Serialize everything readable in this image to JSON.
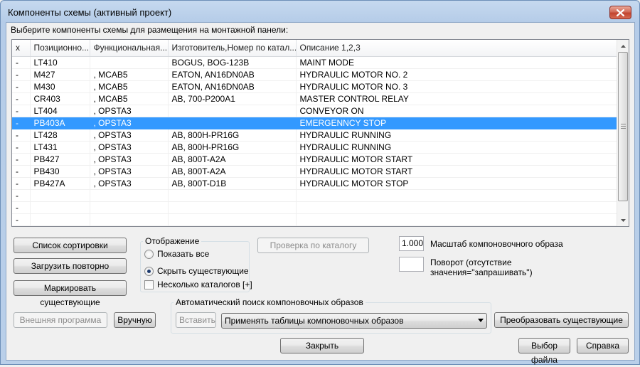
{
  "window": {
    "title": "Компоненты схемы (активный проект)"
  },
  "prompt": "Выберите компоненты схемы для размещения на монтажной панели:",
  "table": {
    "columns": [
      "x",
      "Позиционно...",
      "Функциональная...",
      "Изготовитель,Номер по катал...",
      "Описание 1,2,3"
    ],
    "rows": [
      [
        "-",
        "LT410",
        "",
        "BOGUS, BOG-123B",
        "MAINT MODE"
      ],
      [
        "-",
        "M427",
        ", MCAB5",
        "EATON, AN16DN0AB",
        "HYDRAULIC MOTOR NO. 2"
      ],
      [
        "-",
        "M430",
        ", MCAB5",
        "EATON, AN16DN0AB",
        "HYDRAULIC MOTOR NO. 3"
      ],
      [
        "-",
        "CR403",
        ", MCAB5",
        "AB, 700-P200A1",
        "MASTER CONTROL RELAY"
      ],
      [
        "-",
        "LT404",
        ", OPSTA3",
        "",
        "CONVEYOR ON"
      ],
      [
        "-",
        "PB403A",
        ", OPSTA3",
        "",
        "EMERGENNCY STOP"
      ],
      [
        "-",
        "LT428",
        ", OPSTA3",
        "AB, 800H-PR16G",
        "HYDRAULIC RUNNING"
      ],
      [
        "-",
        "LT431",
        ", OPSTA3",
        "AB, 800H-PR16G",
        "HYDRAULIC RUNNING"
      ],
      [
        "-",
        "PB427",
        ", OPSTA3",
        "AB, 800T-A2A",
        "HYDRAULIC MOTOR START"
      ],
      [
        "-",
        "PB430",
        ", OPSTA3",
        "AB, 800T-A2A",
        "HYDRAULIC MOTOR START"
      ],
      [
        "-",
        "PB427A",
        ", OPSTA3",
        "AB, 800T-D1B",
        "HYDRAULIC MOTOR STOP"
      ],
      [
        "-",
        "",
        "",
        "",
        ""
      ],
      [
        "-",
        "",
        "",
        "",
        ""
      ],
      [
        "-",
        "",
        "",
        "",
        ""
      ]
    ],
    "selected_row": 5
  },
  "buttons": {
    "sort_list": "Список сортировки",
    "reload": "Загрузить повторно",
    "mark_existing": "Маркировать существующие",
    "catalog_check": "Проверка по каталогу",
    "external_program": "Внешняя программа",
    "manual": "Вручную",
    "insert": "Вставить",
    "convert_existing": "Преобразовать существующие",
    "close": "Закрыть",
    "select_file": "Выбор файла",
    "help": "Справка"
  },
  "display_group": {
    "label": "Отображение",
    "show_all": "Показать все",
    "hide_existing": "Скрыть существующие",
    "multiple_catalogs": "Несколько каталогов [+]",
    "selected": "hide_existing",
    "multiple_checked": false
  },
  "scale": {
    "value": "1.000",
    "label": "Масштаб компоновочного образа"
  },
  "rotation": {
    "value": "",
    "label_line1": "Поворот (отсутствие",
    "label_line2": "значения=\"запрашивать\")"
  },
  "auto_search": {
    "label": "Автоматический поиск компоновочных образов",
    "combo_value": "Применять таблицы компоновочных образов"
  }
}
